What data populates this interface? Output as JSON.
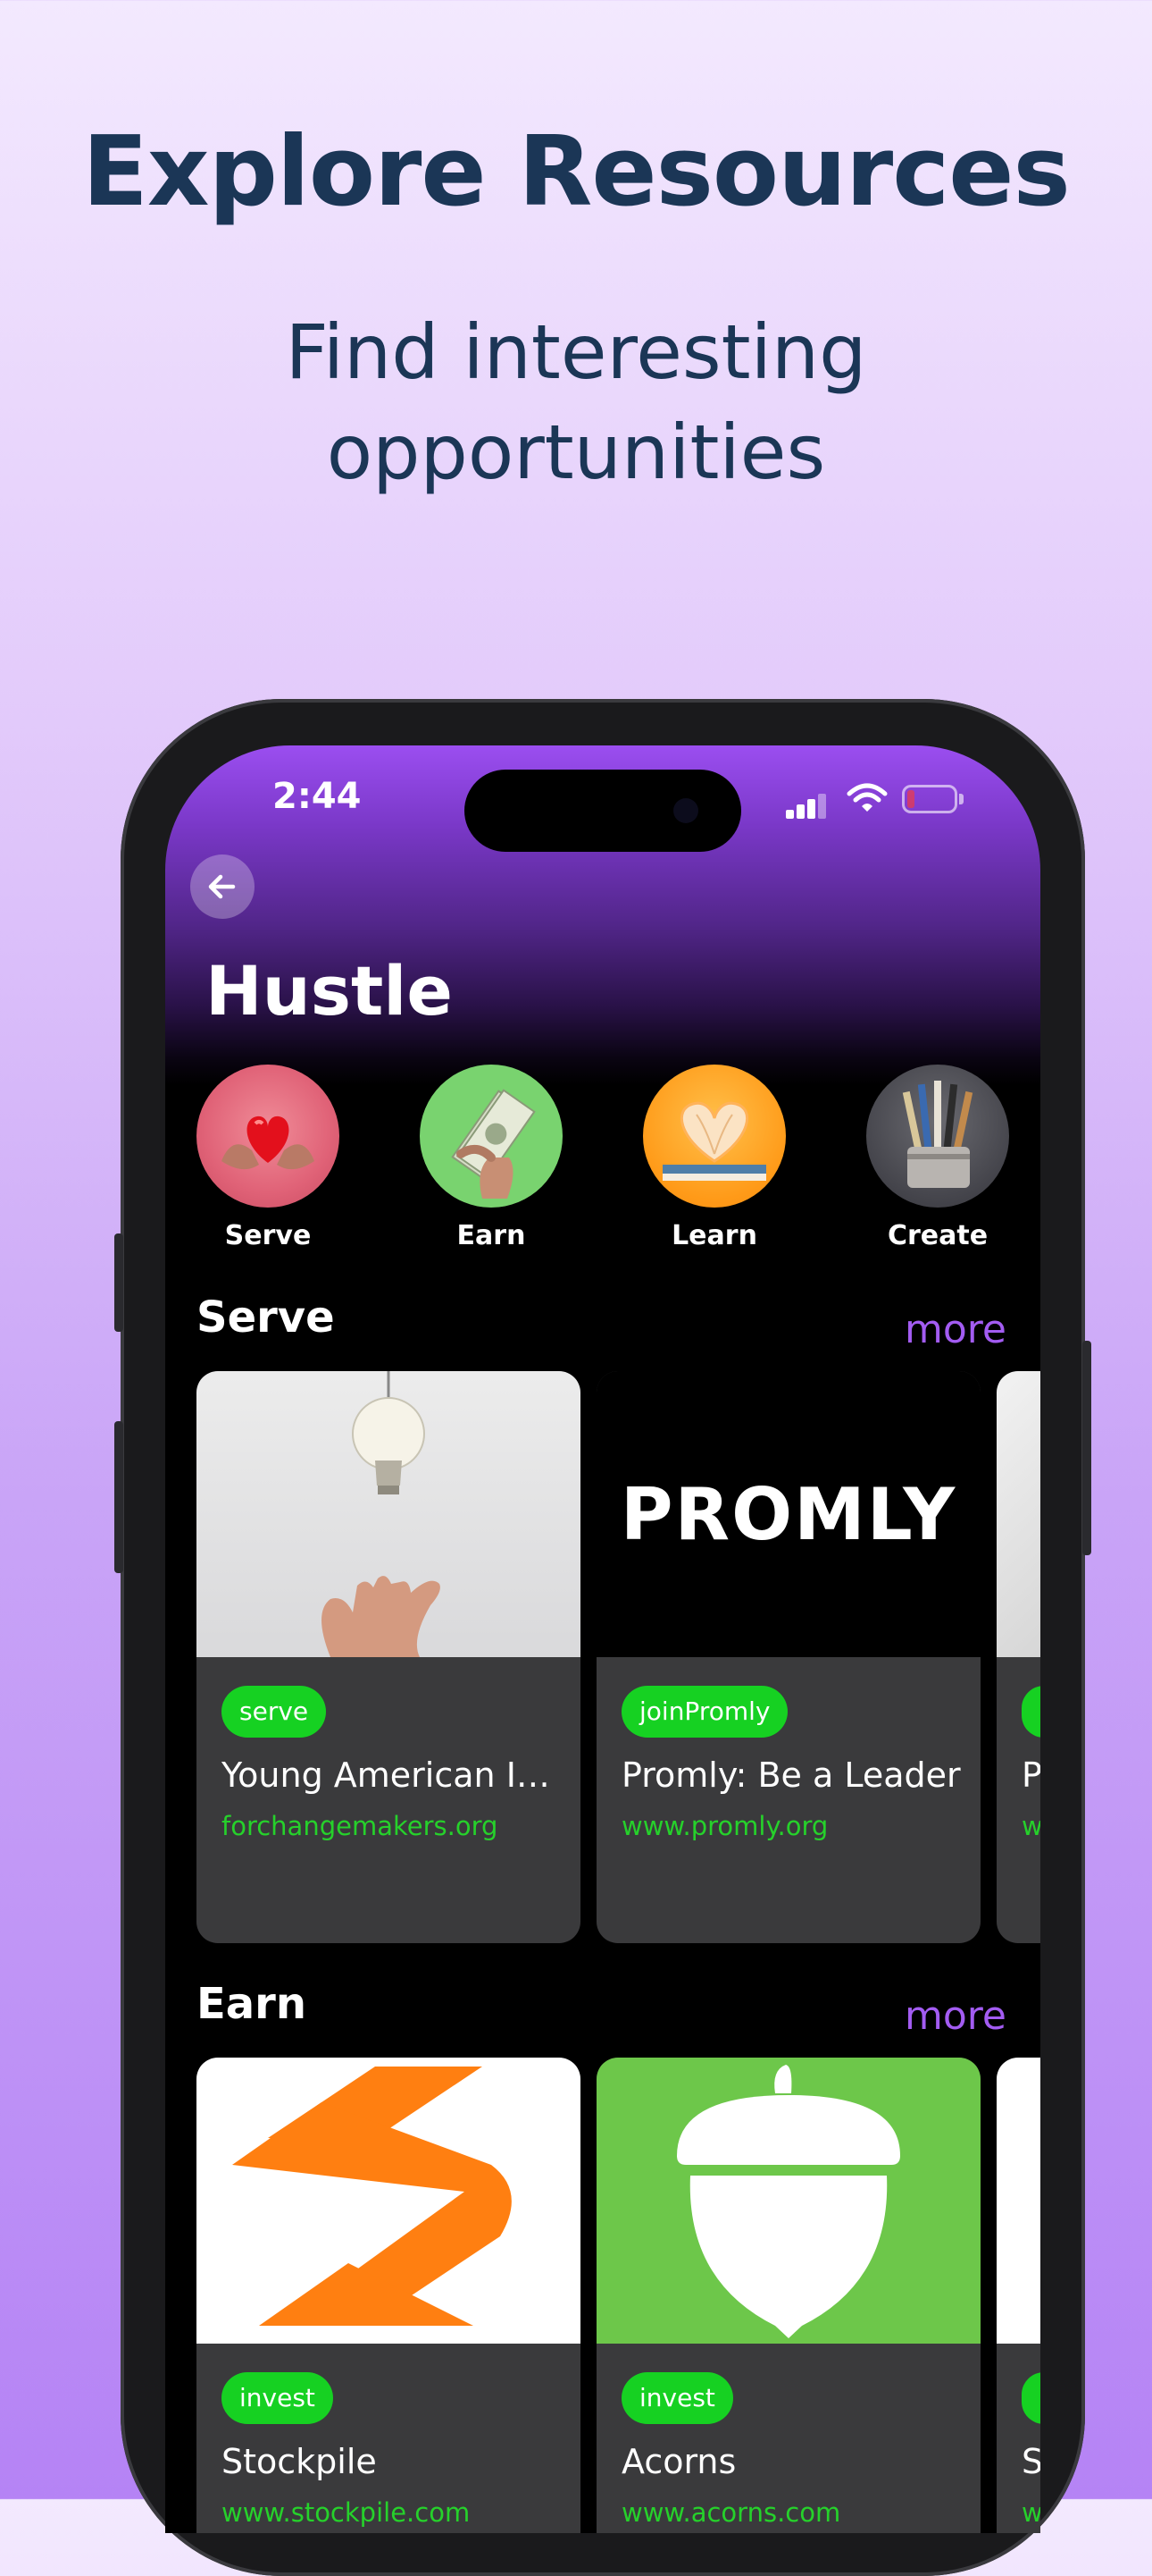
{
  "promo": {
    "headline": "Explore Resources",
    "subheadline_line1": "Find interesting",
    "subheadline_line2": "opportunities"
  },
  "status_bar": {
    "time": "2:44"
  },
  "screen": {
    "title": "Hustle",
    "categories": [
      {
        "label": "Serve",
        "icon": "heart-in-hands-image"
      },
      {
        "label": "Earn",
        "icon": "money-in-hand-image"
      },
      {
        "label": "Learn",
        "icon": "book-heart-image"
      },
      {
        "label": "Create",
        "icon": "paintbrushes-image"
      }
    ],
    "sections": [
      {
        "title": "Serve",
        "more_label": "more",
        "cards": [
          {
            "tag": "serve",
            "title": "Young American In...",
            "url": "forchangemakers.org",
            "image": "lightbulb-hand-image"
          },
          {
            "tag": "joinPromly",
            "title": "Promly: Be a Leader",
            "url": "www.promly.org",
            "image": "promly-logo",
            "logo_text": "PROMLY"
          },
          {
            "tag": "",
            "title": "P",
            "url": "w",
            "image": "marble-image"
          }
        ]
      },
      {
        "title": "Earn",
        "more_label": "more",
        "cards": [
          {
            "tag": "invest",
            "title": "Stockpile",
            "url": "www.stockpile.com",
            "image": "stockpile-logo"
          },
          {
            "tag": "invest",
            "title": "Acorns",
            "url": "www.acorns.com",
            "image": "acorns-logo"
          },
          {
            "tag": "",
            "title": "S",
            "url": "w",
            "image": "partial-card-image"
          }
        ]
      }
    ]
  },
  "colors": {
    "accent_purple": "#a35cf2",
    "tag_green": "#16d122",
    "url_green": "#26d12b",
    "headline_navy": "#1b3656"
  }
}
